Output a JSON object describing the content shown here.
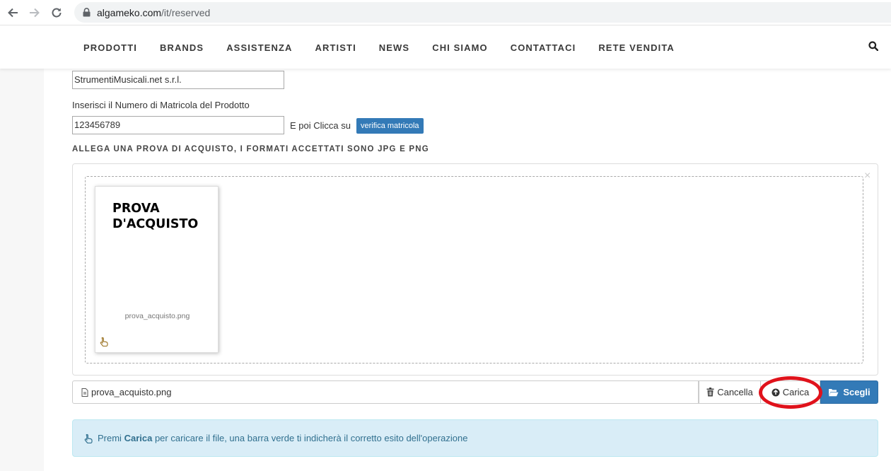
{
  "browser": {
    "url_host": "algameko.com",
    "url_path": "/it/reserved"
  },
  "nav": {
    "items": [
      "PRODOTTI",
      "BRANDS",
      "ASSISTENZA",
      "ARTISTI",
      "NEWS",
      "CHI SIAMO",
      "CONTATTACI",
      "RETE VENDITA"
    ]
  },
  "form": {
    "dealer_value": "StrumentiMusicali.net s.r.l.",
    "serial_label": "Inserisci il Numero di Matricola del Prodotto",
    "serial_value": "123456789",
    "then_click": "E poi Clicca su",
    "verify_button": "verifica matricola",
    "section_title": "ALLEGA UNA PROVA DI ACQUISTO, I FORMATI ACCETTATI SONO JPG E PNG"
  },
  "upload": {
    "preview_title_line1": "PROVA",
    "preview_title_line2": "D'ACQUISTO",
    "preview_filename": "prova_acquisto.png",
    "file_input_value": "prova_acquisto.png",
    "cancel_label": "Cancella",
    "upload_label": "Carica",
    "choose_label": "Scegli",
    "close_symbol": "×"
  },
  "info": {
    "prefix": "Premi",
    "bold": "Carica",
    "suffix": "per caricare il file, una barra verde ti indicherà il corretto esito dell'operazione"
  },
  "colors": {
    "primary": "#337ab7",
    "info_bg": "#d9edf7",
    "info_text": "#31708f",
    "highlight": "#e0121b"
  }
}
